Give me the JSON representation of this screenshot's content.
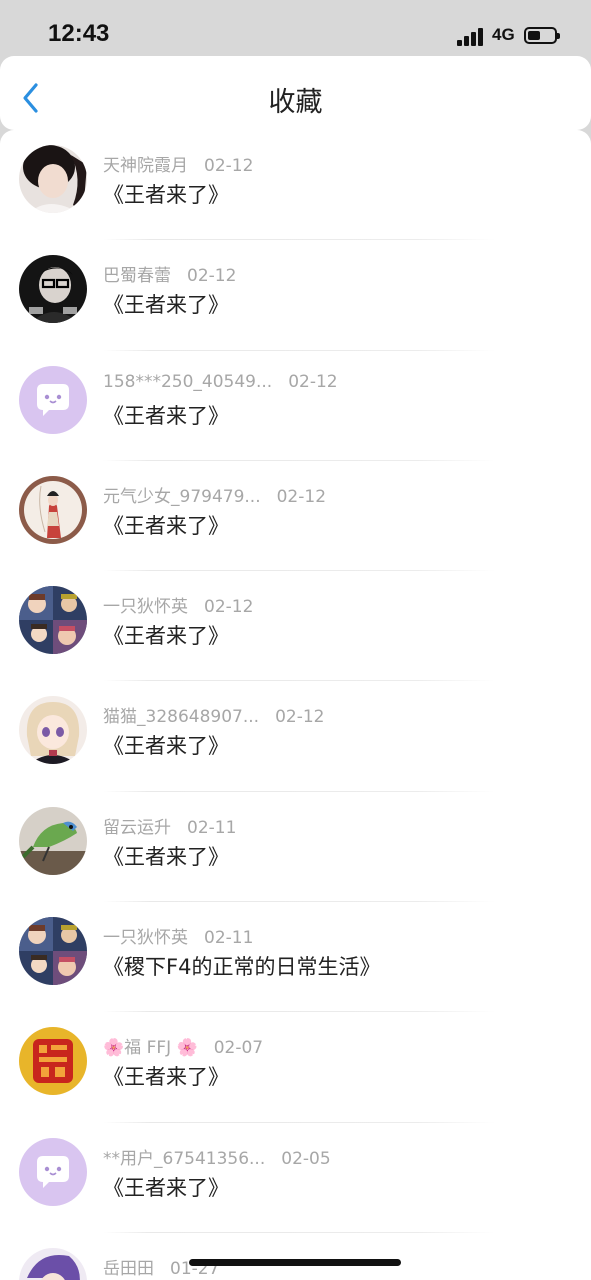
{
  "status_bar": {
    "time": "12:43",
    "network": "4G"
  },
  "header": {
    "title": "收藏"
  },
  "items": [
    {
      "user": "天神院霞月",
      "date": "02-12",
      "title": "《王者来了》",
      "avatar": "photo-girl"
    },
    {
      "user": "巴蜀春蕾",
      "date": "02-12",
      "title": "《王者来了》",
      "avatar": "glasses-boy"
    },
    {
      "user": "158***250_40549...",
      "date": "02-12",
      "title": "《王者来了》",
      "avatar": "default-chat"
    },
    {
      "user": "元气少女_979479...",
      "date": "02-12",
      "title": "《王者来了》",
      "avatar": "ancient-lady"
    },
    {
      "user": "一只狄怀英",
      "date": "02-12",
      "title": "《王者来了》",
      "avatar": "comic-collage"
    },
    {
      "user": "猫猫_328648907...",
      "date": "02-12",
      "title": "《王者来了》",
      "avatar": "anime-girl"
    },
    {
      "user": "留云运升",
      "date": "02-11",
      "title": "《王者来了》",
      "avatar": "parrot"
    },
    {
      "user": "一只狄怀英",
      "date": "02-11",
      "title": "《稷下F4的正常的日常生活》",
      "avatar": "comic-collage"
    },
    {
      "user": "🌸福 FFJ 🌸",
      "date": "02-07",
      "title": "《王者来了》",
      "avatar": "fu-character"
    },
    {
      "user": "**用户_67541356...",
      "date": "02-05",
      "title": "《王者来了》",
      "avatar": "default-chat"
    },
    {
      "user": "岳田田",
      "date": "01-27",
      "title": "",
      "avatar": "anime-purple"
    }
  ]
}
